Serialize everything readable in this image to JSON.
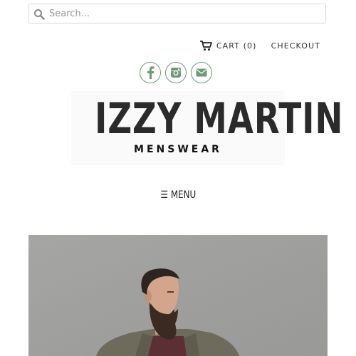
{
  "search": {
    "placeholder": "Search..."
  },
  "cart": {
    "label": "CART (0)"
  },
  "checkout": {
    "label": "CHECKOUT"
  },
  "social": [
    "facebook",
    "instagram",
    "email"
  ],
  "brand": {
    "name": "IZZY MARTIN",
    "tagline": "MENSWEAR"
  },
  "nav": {
    "menu_label": "☰ MENU"
  },
  "colors": {
    "social_green": "#6f9a78"
  }
}
